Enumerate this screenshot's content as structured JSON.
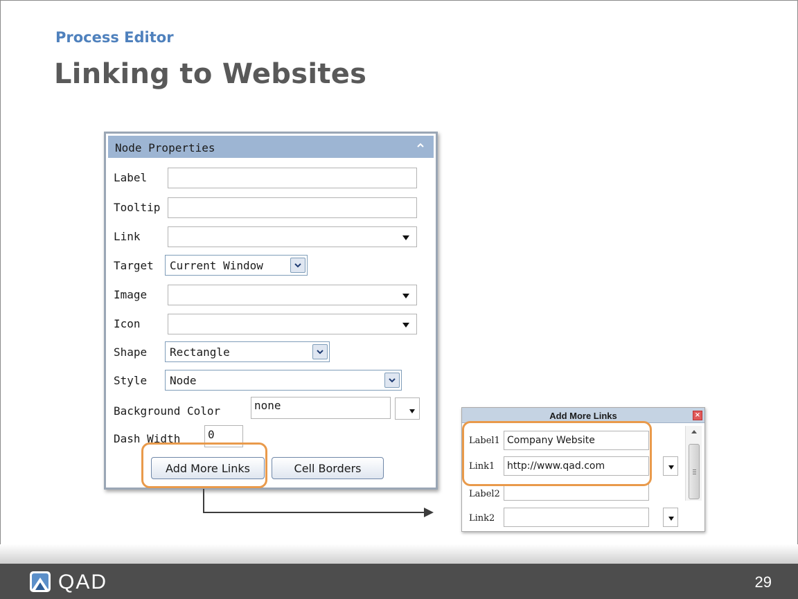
{
  "slide": {
    "section": "Process Editor",
    "title": "Linking to Websites",
    "page_number": "29"
  },
  "node_properties": {
    "header": "Node Properties",
    "fields": {
      "label": {
        "label": "Label",
        "value": ""
      },
      "tooltip": {
        "label": "Tooltip",
        "value": ""
      },
      "link": {
        "label": "Link",
        "value": ""
      },
      "target": {
        "label": "Target",
        "value": "Current Window"
      },
      "image": {
        "label": "Image",
        "value": ""
      },
      "icon": {
        "label": "Icon",
        "value": ""
      },
      "shape": {
        "label": "Shape",
        "value": "Rectangle"
      },
      "style": {
        "label": "Style",
        "value": "Node"
      },
      "background_color": {
        "label": "Background Color",
        "value": "none"
      },
      "dash_width": {
        "label": "Dash Width",
        "value": "0"
      }
    },
    "buttons": {
      "add_more_links": "Add More Links",
      "cell_borders": "Cell Borders"
    }
  },
  "add_more_links_dialog": {
    "title": "Add More Links",
    "rows": [
      {
        "label": "Label1",
        "value": "Company Website"
      },
      {
        "label": "Link1",
        "value": "http://www.qad.com"
      },
      {
        "label": "Label2",
        "value": ""
      },
      {
        "label": "Link2",
        "value": ""
      }
    ]
  },
  "footer": {
    "logo_text": "QAD"
  },
  "colors": {
    "subtitle": "#4f81bd",
    "title": "#595959",
    "highlight": "#e99a4b",
    "panel_header": "#9db5d3",
    "footer": "#4d4d4d"
  }
}
